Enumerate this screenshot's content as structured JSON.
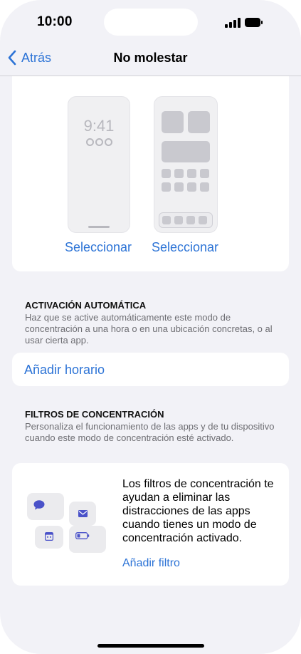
{
  "status_bar": {
    "time": "10:00"
  },
  "nav": {
    "back_label": "Atrás",
    "title": "No molestar"
  },
  "previews": {
    "lock_time": "9:41",
    "select_left": "Seleccionar",
    "select_right": "Seleccionar"
  },
  "activation": {
    "header": "ACTIVACIÓN AUTOMÁTICA",
    "description": "Haz que se active automáticamente este modo de concentración a una hora o en una ubicación concretas, o al usar cierta app.",
    "add_schedule": "Añadir horario"
  },
  "filters": {
    "header": "FILTROS DE CONCENTRACIÓN",
    "description": "Personaliza el funcionamiento de las apps y de tu dispositivo cuando este modo de concentración esté activado.",
    "info_text": "Los filtros de concentración te ayudan a eliminar las distracciones de las apps cuando tienes un modo de concentración activado.",
    "add_filter": "Añadir filtro"
  },
  "colors": {
    "accent": "#2c73d6",
    "icon": "#4a52c9",
    "background": "#f2f2f7"
  }
}
